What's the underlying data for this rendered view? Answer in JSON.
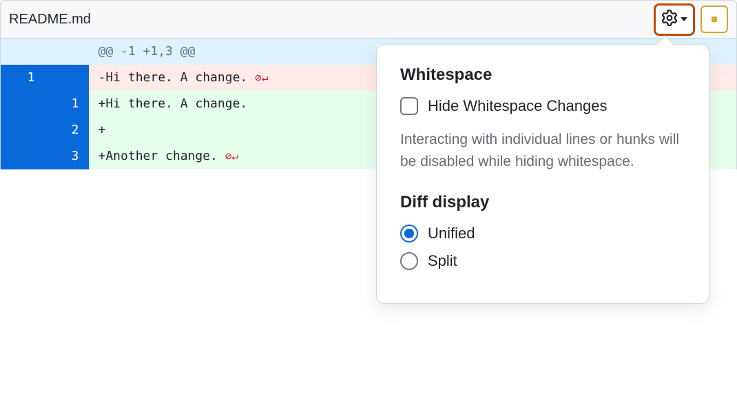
{
  "file": {
    "name": "README.md"
  },
  "diff": {
    "hunk_header": "@@ -1 +1,3 @@",
    "rows": [
      {
        "old": "1",
        "new": "",
        "prefix": "-",
        "text": "Hi there. A change.",
        "no_newline": true,
        "type": "del"
      },
      {
        "old": "",
        "new": "1",
        "prefix": "+",
        "text": "Hi there. A change.",
        "no_newline": false,
        "type": "add"
      },
      {
        "old": "",
        "new": "2",
        "prefix": "+",
        "text": "",
        "no_newline": false,
        "type": "add"
      },
      {
        "old": "",
        "new": "3",
        "prefix": "+",
        "text": "Another change.",
        "no_newline": true,
        "type": "add"
      }
    ]
  },
  "settings": {
    "whitespace_heading": "Whitespace",
    "hide_whitespace_label": "Hide Whitespace Changes",
    "hide_whitespace_checked": false,
    "whitespace_note": "Interacting with individual lines or hunks will be disabled while hiding whitespace.",
    "diff_display_heading": "Diff display",
    "options": {
      "unified": "Unified",
      "split": "Split"
    },
    "selected": "unified"
  }
}
